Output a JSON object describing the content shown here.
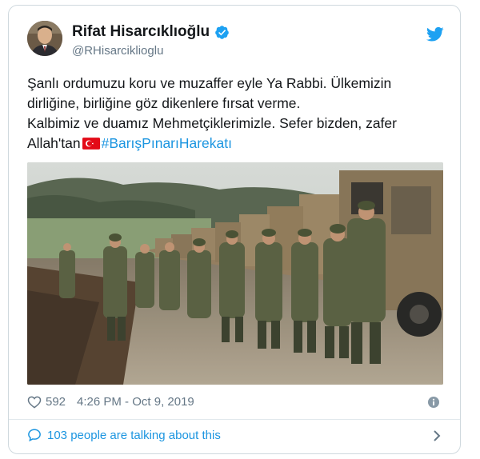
{
  "tweet": {
    "display_name": "Rifat Hisarcıklıoğlu",
    "handle": "@RHisarciklioglu",
    "verified": true,
    "text_line_1": "Şanlı ordumuzu koru ve muzaffer eyle Ya Rabbi. Ülkemizin dirliğine, birliğine göz dikenlere fırsat verme.",
    "text_line_2_pre": "Kalbimiz ve duamız Mehmetçiklerimizle. Sefer bizden, zafer Allah'tan",
    "hashtag": "#BarışPınarıHarekatı",
    "likes": "592",
    "timestamp": "4:26 PM - Oct 9, 2019",
    "talking": "103 people are talking about this"
  },
  "icons": {
    "verified": "verified-badge-icon",
    "twitter": "twitter-bird-icon",
    "like": "heart-icon",
    "info": "info-icon",
    "reply": "speech-bubble-icon",
    "chevron": "chevron-right-icon",
    "flag": "turkey-flag-icon"
  },
  "colors": {
    "accent": "#1b95e0",
    "text": "#14171a",
    "muted": "#657786",
    "border": "#cfd9de",
    "flag_red": "#e30a17"
  }
}
